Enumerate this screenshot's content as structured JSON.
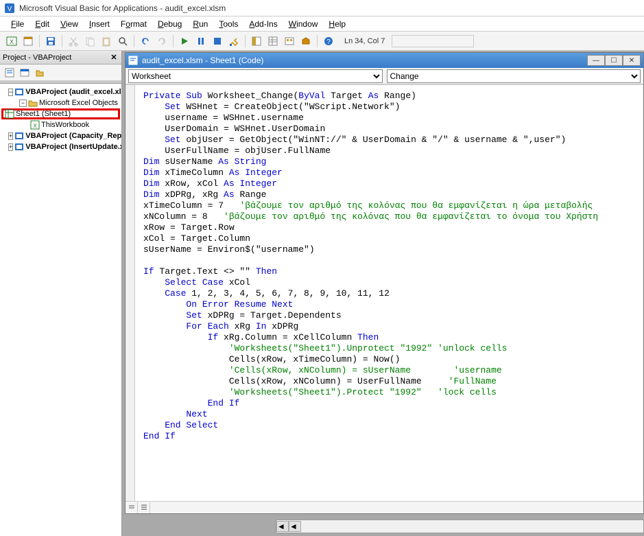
{
  "title": "Microsoft Visual Basic for Applications - audit_excel.xlsm",
  "menu": [
    "File",
    "Edit",
    "View",
    "Insert",
    "Format",
    "Debug",
    "Run",
    "Tools",
    "Add-Ins",
    "Window",
    "Help"
  ],
  "status": "Ln 34, Col 7",
  "project_panel_title": "Project - VBAProject",
  "tree": {
    "p1": "VBAProject (audit_excel.xlsm)",
    "p1_folder": "Microsoft Excel Objects",
    "p1_sheet1": "Sheet1 (Sheet1)",
    "p1_wb": "ThisWorkbook",
    "p2": "VBAProject (Capacity_Report.xlsm)",
    "p3": "VBAProject (InsertUpdate.xlsm)"
  },
  "code_window_title": "audit_excel.xlsm - Sheet1 (Code)",
  "dropdown_left": "Worksheet",
  "dropdown_right": "Change",
  "code": {
    "l1_a": "Private Sub",
    "l1_b": " Worksheet_Change(",
    "l1_c": "ByVal",
    "l1_d": " Target ",
    "l1_e": "As",
    "l1_f": " Range)",
    "l2_a": "    Set",
    "l2_b": " WSHnet = CreateObject(\"WScript.Network\")",
    "l3": "    username = WSHnet.username",
    "l4": "    UserDomain = WSHnet.UserDomain",
    "l5_a": "    Set",
    "l5_b": " objUser = GetObject(\"WinNT://\" & UserDomain & \"/\" & username & \",user\")",
    "l6": "    UserFullName = objUser.FullName",
    "l7_a": "Dim",
    "l7_b": " sUserName ",
    "l7_c": "As String",
    "l8_a": "Dim",
    "l8_b": " xTimeColumn ",
    "l8_c": "As Integer",
    "l9_a": "Dim",
    "l9_b": " xRow, xCol ",
    "l9_c": "As Integer",
    "l10_a": "Dim",
    "l10_b": " xDPRg, xRg ",
    "l10_c": "As",
    "l10_d": " Range",
    "l11_a": "xTimeColumn = 7   ",
    "l11_b": "'βάζουμε τον αριθμό της κολόνας που θα εμφανίζεται η ώρα μεταβολής",
    "l12_a": "xNColumn = 8   ",
    "l12_b": "'βάζουμε τον αριθμό της κολόνας που θα εμφανίζεται το όνομα του Χρήστη",
    "l13": "xRow = Target.Row",
    "l14": "xCol = Target.Column",
    "l15": "sUserName = Environ$(\"username\")",
    "blank": "",
    "l16_a": "If",
    "l16_b": " Target.Text <> \"\" ",
    "l16_c": "Then",
    "l17_a": "    Select Case",
    "l17_b": " xCol",
    "l18_a": "    Case",
    "l18_b": " 1, 2, 3, 4, 5, 6, 7, 8, 9, 10, 11, 12",
    "l19": "        On Error Resume Next",
    "l20_a": "        Set",
    "l20_b": " xDPRg = Target.Dependents",
    "l21_a": "        For Each",
    "l21_b": " xRg ",
    "l21_c": "In",
    "l21_d": " xDPRg",
    "l22_a": "            If",
    "l22_b": " xRg.Column = xCellColumn ",
    "l22_c": "Then",
    "l23": "                'Worksheets(\"Sheet1\").Unprotect \"1992\" 'unlock cells",
    "l24": "                Cells(xRow, xTimeColumn) = Now()",
    "l25_a": "                'Cells(xRow, xNColumn) = sUserName        ",
    "l25_b": "'username",
    "l26_a": "                Cells(xRow, xNColumn) = UserFullName     ",
    "l26_b": "'FullName",
    "l27": "                'Worksheets(\"Sheet1\").Protect \"1992\"   'lock cells",
    "l28": "            End If",
    "l29": "        Next",
    "l30": "    End Select",
    "l31": "End If"
  }
}
